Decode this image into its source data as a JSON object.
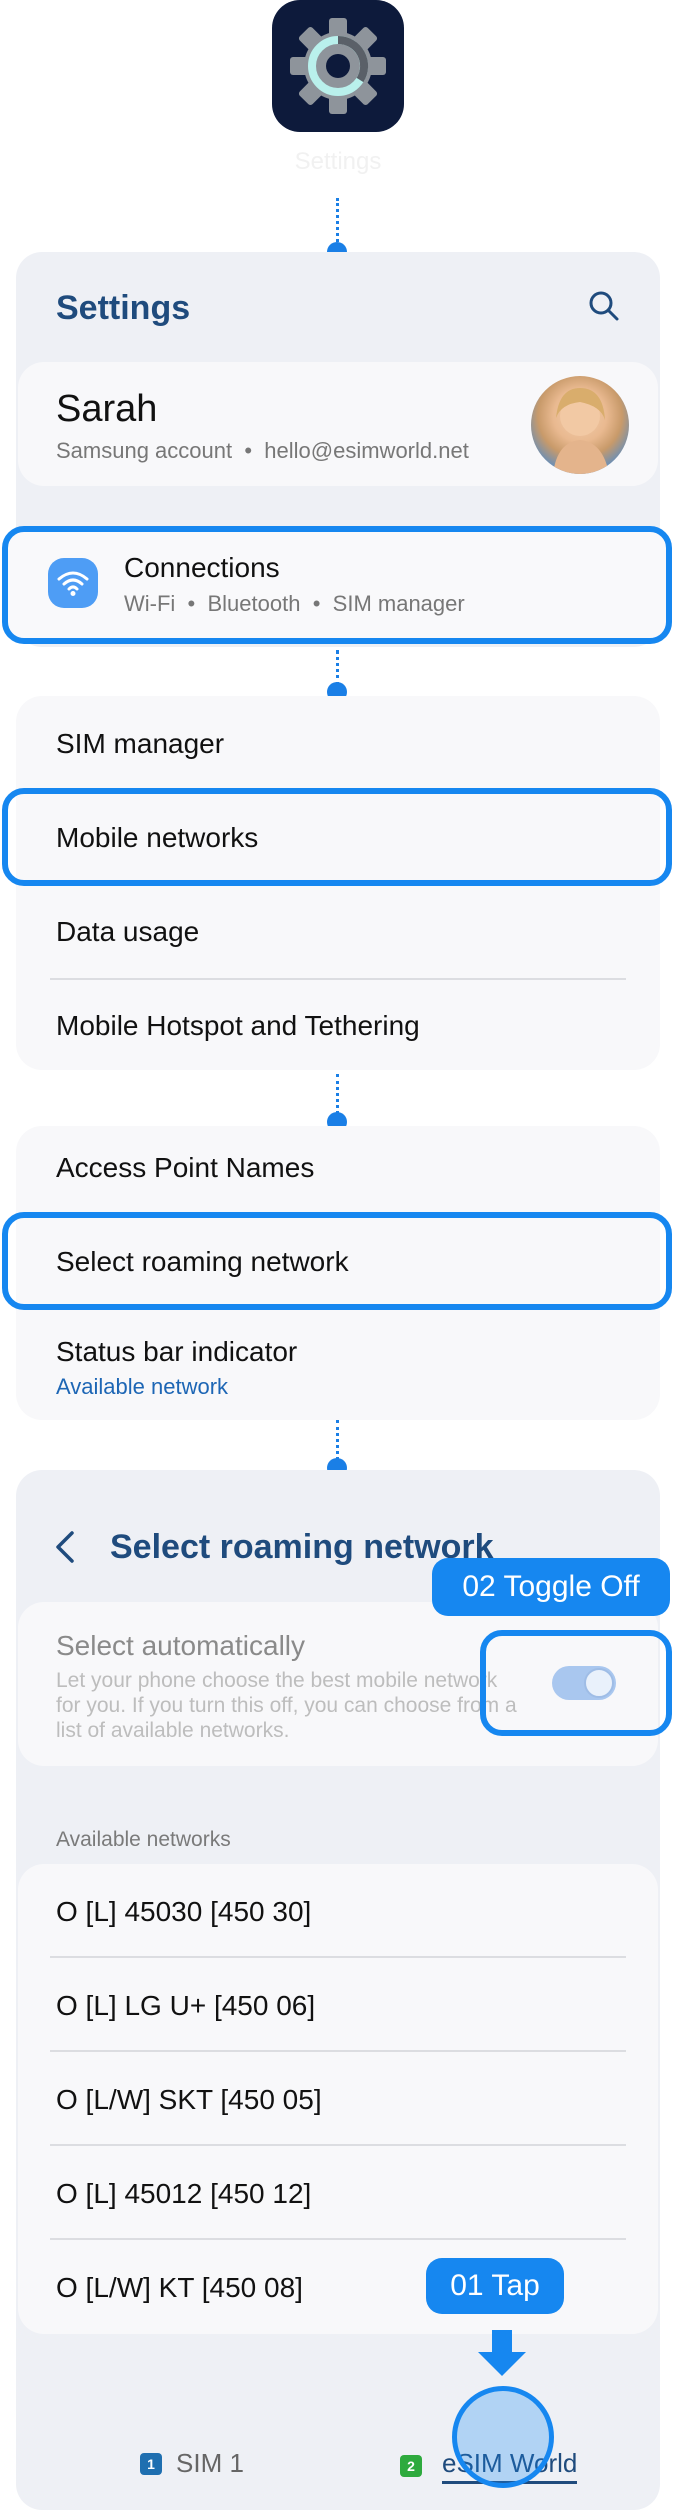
{
  "app": {
    "label": "Settings"
  },
  "settings_panel": {
    "title": "Settings",
    "profile": {
      "name": "Sarah",
      "account": "Samsung account",
      "email": "hello@esimworld.net"
    },
    "connections": {
      "title": "Connections",
      "sub": [
        "Wi-Fi",
        "Bluetooth",
        "SIM manager"
      ]
    }
  },
  "connections_menu": {
    "items": [
      "SIM manager",
      "Mobile networks",
      "Data usage",
      "Mobile Hotspot and Tethering"
    ]
  },
  "mobile_networks_menu": {
    "items": [
      "Access Point Names",
      "Select roaming network",
      "Status bar indicator"
    ],
    "status_sub": "Available network"
  },
  "roaming_screen": {
    "title": "Select roaming network",
    "auto_title": "Select automatically",
    "auto_desc": "Let your phone choose the best mobile network for you. If you turn this off, you can choose from a list of available networks.",
    "auto_enabled": true,
    "section_label": "Available networks",
    "networks": [
      "O [L] 45030 [450 30]",
      "O [L] LG U+ [450 06]",
      "O [L/W] SKT [450 05]",
      "O [L] 45012 [450 12]",
      "O [L/W] KT [450 08]"
    ],
    "tabs": [
      {
        "badge": "1",
        "label": "SIM 1"
      },
      {
        "badge": "2",
        "label": "eSIM World"
      }
    ]
  },
  "annotations": {
    "step1": "01 Tap",
    "step2": "02 Toggle Off"
  },
  "colors": {
    "accent": "#1687f0",
    "title_blue": "#1f4b7d",
    "app_icon_bg": "#0d1a3b"
  }
}
